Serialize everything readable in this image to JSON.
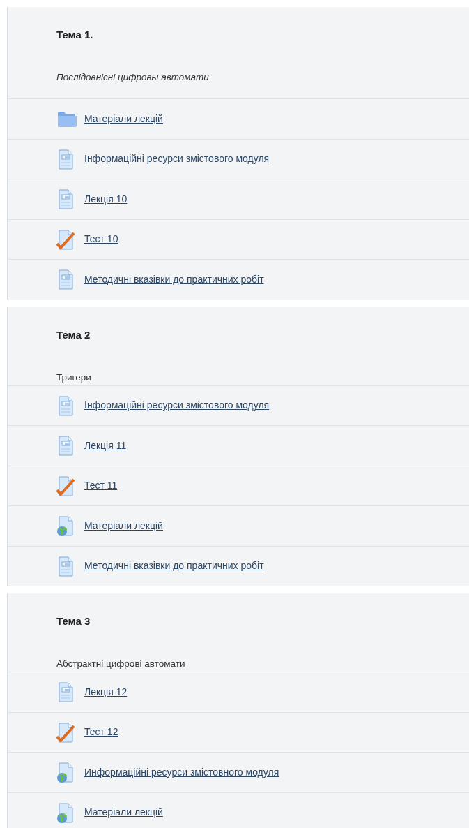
{
  "sections": [
    {
      "title": "Тема 1.",
      "summary": "Послідовнісні цифровы автомати",
      "summary_italic": true,
      "items": [
        {
          "kind": "folder",
          "label": "Матеріали лекцій"
        },
        {
          "kind": "page",
          "label": "Інформаційні ресурси змістового модуля"
        },
        {
          "kind": "page",
          "label": "Лекція 10"
        },
        {
          "kind": "quiz",
          "label": "Тест 10"
        },
        {
          "kind": "page",
          "label": "Методичні вказівки до практичних робіт"
        }
      ]
    },
    {
      "title": "Тема 2",
      "summary": "Тригери",
      "summary_italic": false,
      "items": [
        {
          "kind": "page",
          "label": "Інформаційні ресурси змістового модуля"
        },
        {
          "kind": "page",
          "label": "Лекція 11"
        },
        {
          "kind": "quiz",
          "label": "Тест 11"
        },
        {
          "kind": "url",
          "label": "Матеріали лекцій"
        },
        {
          "kind": "page",
          "label": "Методичні вказівки до практичних робіт"
        }
      ]
    },
    {
      "title": "Тема 3",
      "summary": "Абстрактні цифрові автомати",
      "summary_italic": false,
      "items": [
        {
          "kind": "page",
          "label": "Лекція 12"
        },
        {
          "kind": "quiz",
          "label": "Тест 12"
        },
        {
          "kind": "url",
          "label": "Информаційні ресурси змістовного модуля"
        },
        {
          "kind": "url",
          "label": "Матеріали лекцій"
        }
      ]
    }
  ]
}
